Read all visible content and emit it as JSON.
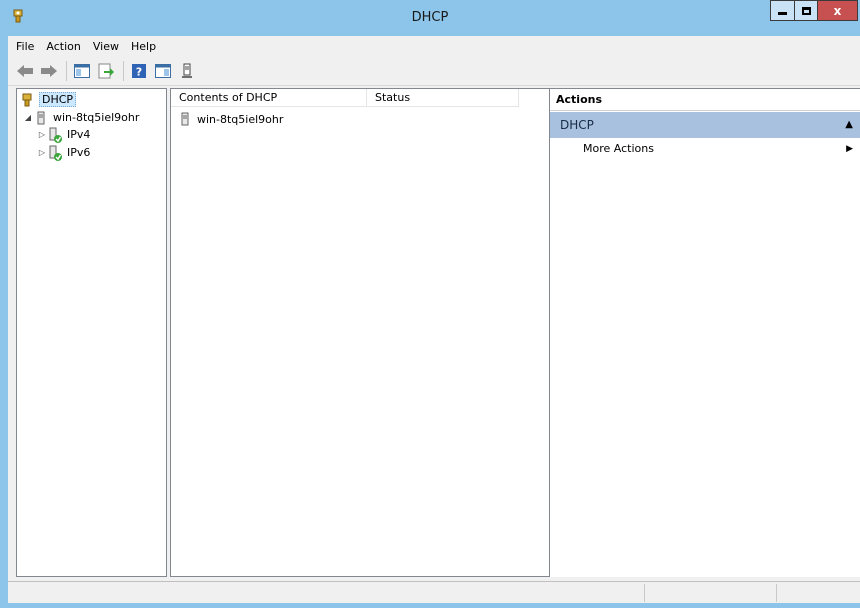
{
  "window": {
    "title": "DHCP"
  },
  "controls": {
    "close_label": "x"
  },
  "menu": [
    "File",
    "Action",
    "View",
    "Help"
  ],
  "tree": {
    "root": "DHCP",
    "server": "win-8tq5iel9ohr",
    "children": [
      "IPv4",
      "IPv6"
    ]
  },
  "list": {
    "columns": [
      "Contents of DHCP",
      "Status"
    ],
    "rows": [
      {
        "name": "win-8tq5iel9ohr",
        "status": ""
      }
    ]
  },
  "actions": {
    "header": "Actions",
    "section": "DHCP",
    "items": [
      "More Actions"
    ]
  },
  "colors": {
    "titlebar": "#8cc4ea",
    "close": "#c75050",
    "section": "#a8c1df"
  }
}
